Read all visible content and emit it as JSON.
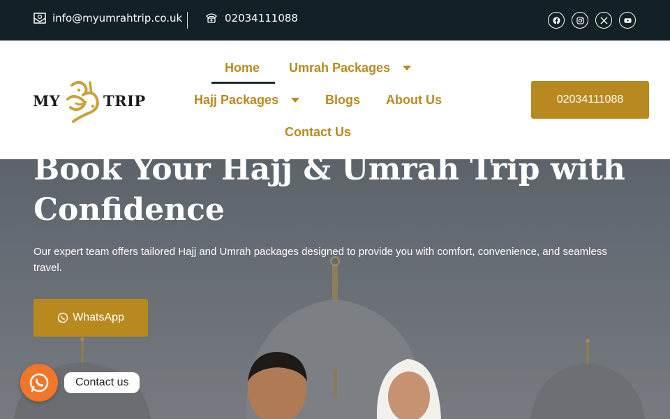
{
  "topbar": {
    "email": "info@myumrahtrip.co.uk",
    "email_icon": "envelope-icon",
    "phone": "02034111088",
    "phone_icon": "phone-icon",
    "socials": [
      "facebook-icon",
      "instagram-icon",
      "x-icon",
      "youtube-icon"
    ]
  },
  "header": {
    "logo": {
      "left": "MY",
      "right": "TRIP"
    },
    "nav": {
      "home": "Home",
      "umrah": "Umrah Packages",
      "hajj": "Hajj Packages",
      "blogs": "Blogs",
      "about": "About Us",
      "contact": "Contact Us"
    },
    "cta_phone": "02034111088"
  },
  "hero": {
    "title": "Book Your Hajj & Umrah Trip with Confidence",
    "subtitle": "Our expert team offers tailored Hajj and Umrah packages designed to provide you with comfort, convenience, and seamless travel.",
    "whatsapp_label": "WhatsApp"
  },
  "floating": {
    "label": "Contact us"
  },
  "colors": {
    "accent": "#b8891f",
    "topbar_bg": "#132026",
    "float_bg": "#f2762a"
  }
}
